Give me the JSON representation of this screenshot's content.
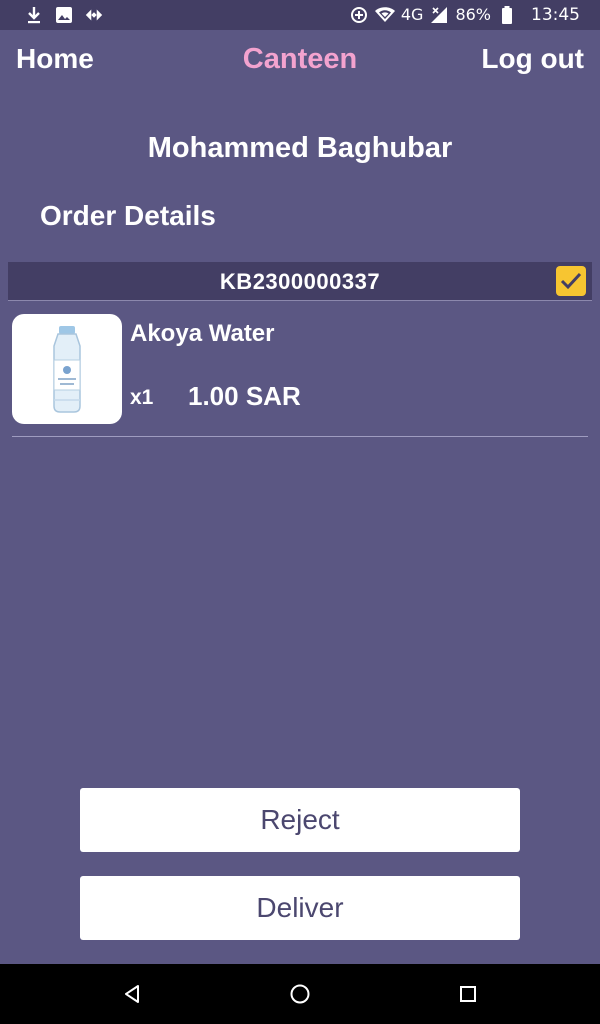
{
  "status_bar": {
    "left_icons": [
      "download-icon",
      "image-icon",
      "diamond-arrows-icon"
    ],
    "right_icons": [
      "data-saver-icon",
      "wifi-icon",
      "signal-icon",
      "battery-icon"
    ],
    "network": "4G",
    "battery": "86%",
    "time": "13:45"
  },
  "nav": {
    "home": "Home",
    "title": "Canteen",
    "logout": "Log out",
    "title_color": "#f3a3cf"
  },
  "user": {
    "name": "Mohammed Baghubar"
  },
  "section_title": "Order Details",
  "order": {
    "id": "KB2300000337",
    "checked": true,
    "items": [
      {
        "name": "Akoya Water",
        "qty": "x1",
        "price": "1.00 SAR",
        "thumb_icon": "water-bottle-icon"
      }
    ]
  },
  "buttons": {
    "reject": "Reject",
    "deliver": "Deliver"
  },
  "system_nav": {
    "icons": [
      "back-icon",
      "home-circle-icon",
      "recents-square-icon"
    ]
  },
  "colors": {
    "background": "#5b5783",
    "header_bar": "#433e64",
    "check_accent": "#f7c531"
  }
}
